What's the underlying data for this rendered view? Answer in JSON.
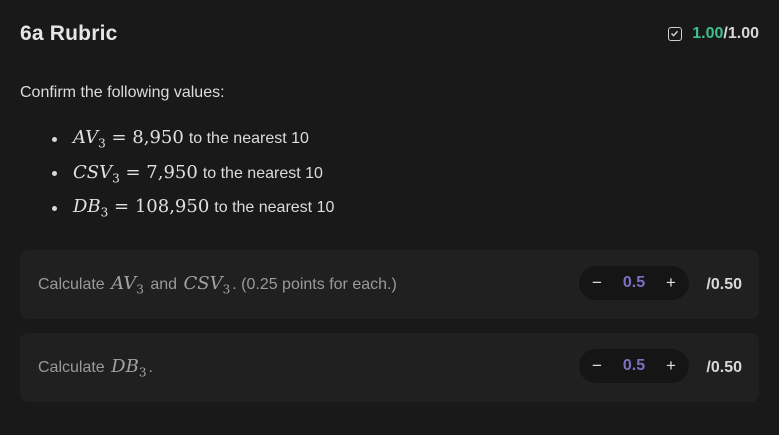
{
  "rubric": {
    "title": "6a Rubric",
    "score_earned": "1.00",
    "score_total": "/1.00",
    "status_icon": "checkbox-checked-icon",
    "accent_color": "#3fbf8a"
  },
  "instructions": {
    "intro": "Confirm the following values:",
    "items": [
      {
        "var": "AV",
        "sub": "3",
        "eq": " = 8,950",
        "suffix": "to the nearest 10"
      },
      {
        "var": "CSV",
        "sub": "3",
        "eq": " = 7,950",
        "suffix": "to the nearest 10"
      },
      {
        "var": "DB",
        "sub": "3",
        "eq": " = 108,950",
        "suffix": "to the nearest 10"
      }
    ]
  },
  "criteria": [
    {
      "text_prefix": "Calculate ",
      "var1": "AV",
      "sub1": "3",
      "mid": " and ",
      "var2": "CSV",
      "sub2": "3",
      "text_suffix": ". (0.25 points for each.)",
      "minus_label": "−",
      "value": "0.5",
      "plus_label": "+",
      "max": "/0.50"
    },
    {
      "text_prefix": "Calculate ",
      "var1": "DB",
      "sub1": "3",
      "text_suffix": ".",
      "minus_label": "−",
      "value": "0.5",
      "plus_label": "+",
      "max": "/0.50"
    }
  ],
  "colors": {
    "background": "#19191a",
    "card": "#202021",
    "stepper_value": "#7d6fc4"
  }
}
